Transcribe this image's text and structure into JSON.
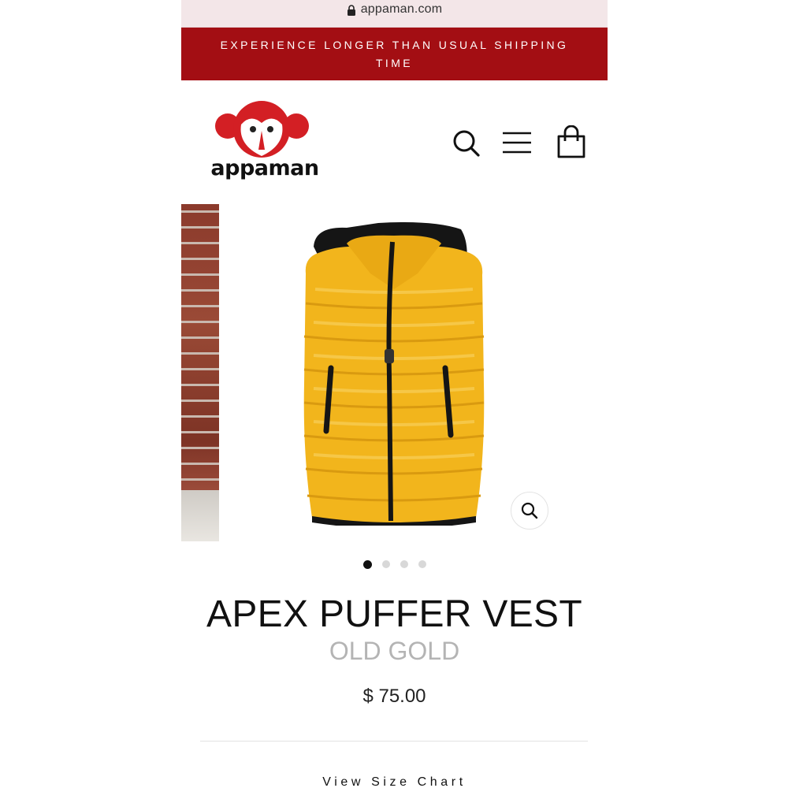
{
  "browser": {
    "url": "appaman.com"
  },
  "announcement": {
    "text": "EXPERIENCE LONGER THAN USUAL SHIPPING TIME",
    "background": "#a30e13"
  },
  "header": {
    "logo_text": "appaman",
    "icons": [
      "search-icon",
      "hamburger-menu-icon",
      "shopping-bag-icon"
    ]
  },
  "gallery": {
    "slide_count": 4,
    "active_slide": 1,
    "main_image": "yellow hooded puffer vest",
    "zoom_icon": "zoom-icon"
  },
  "product": {
    "title": "APEX PUFFER VEST",
    "variant": "OLD GOLD",
    "price": "$ 75.00",
    "size_chart_link": "View Size Chart"
  },
  "colors": {
    "accent": "#a30e13",
    "vest": "#f2b51c"
  }
}
